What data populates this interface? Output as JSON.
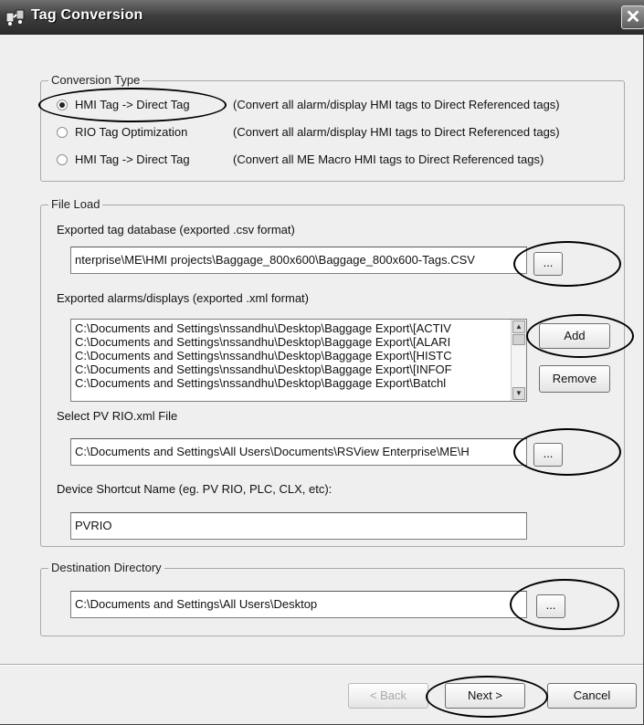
{
  "window": {
    "title": "Tag Conversion",
    "close_glyph": "✕"
  },
  "conversion_type": {
    "legend": "Conversion Type",
    "options": [
      {
        "label": "HMI Tag -> Direct Tag",
        "description": "(Convert all alarm/display HMI tags to Direct Referenced tags)",
        "selected": true
      },
      {
        "label": "RIO Tag Optimization",
        "description": "(Convert all alarm/display HMI tags to Direct Referenced tags)",
        "selected": false
      },
      {
        "label": "HMI Tag -> Direct Tag",
        "description": "(Convert all ME Macro HMI tags to Direct Referenced tags)",
        "selected": false
      }
    ]
  },
  "file_load": {
    "legend": "File Load",
    "tag_db_label": "Exported tag database (exported .csv format)",
    "tag_db_value": "nterprise\\ME\\HMI projects\\Baggage_800x600\\Baggage_800x600-Tags.CSV",
    "browse_label": "...",
    "alarms_label": "Exported alarms/displays (exported .xml format)",
    "alarms_items": [
      "C:\\Documents and Settings\\nssandhu\\Desktop\\Baggage Export\\[ACTIV",
      "C:\\Documents and Settings\\nssandhu\\Desktop\\Baggage Export\\[ALARI",
      "C:\\Documents and Settings\\nssandhu\\Desktop\\Baggage Export\\[HISTC",
      "C:\\Documents and Settings\\nssandhu\\Desktop\\Baggage Export\\[INFOF",
      "C:\\Documents and Settings\\nssandhu\\Desktop\\Baggage Export\\Batchl"
    ],
    "add_label": "Add",
    "remove_label": "Remove",
    "pv_rio_label": "Select PV RIO.xml File",
    "pv_rio_value": "C:\\Documents and Settings\\All Users\\Documents\\RSView Enterprise\\ME\\H",
    "shortcut_label": "Device Shortcut Name (eg. PV RIO, PLC, CLX, etc):",
    "shortcut_value": "PVRIO"
  },
  "destination": {
    "legend": "Destination Directory",
    "value": "C:\\Documents and Settings\\All Users\\Desktop",
    "browse_label": "..."
  },
  "footer": {
    "back_label": "< Back",
    "next_label": "Next >",
    "cancel_label": "Cancel"
  },
  "colors": {
    "titlebar": "#3e3e3e",
    "dialog_bg": "#efefef",
    "annotation": "#000000"
  }
}
